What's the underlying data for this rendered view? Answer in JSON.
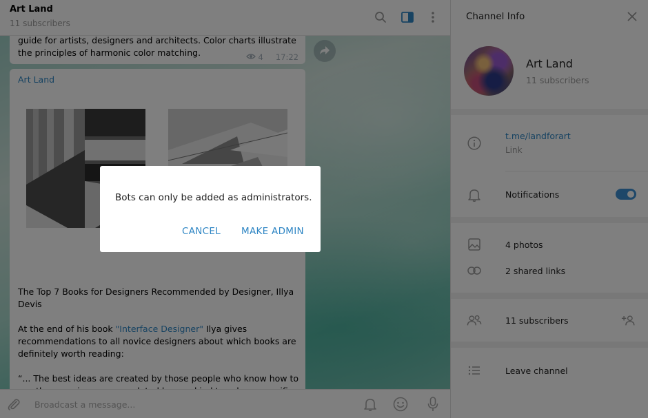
{
  "chat": {
    "title": "Art Land",
    "subtitle": "11 subscribers",
    "top_message": {
      "text": "guide for artists, designers and architects. Color charts illustrate the principles of harmonic color matching.",
      "views": "4",
      "time": "17:22"
    },
    "post": {
      "author": "Art Land",
      "heading": "The Top 7 Books for Designers Recommended by Designer, Illya Devis",
      "para2_pre": "At the end of his book ",
      "para2_link": "\"Interface Designer\"",
      "para2_post": " Ilya gives recommendations to all novice designers about which books are definitely worth reading:",
      "para3": "“... The best ideas are created by those people who know how to use the experience accumulated by mankind to solve a specific problem. That is why it is important for a designer to look at things broadly, reading books of different genres, and communicating with"
    },
    "composer_placeholder": "Broadcast a message..."
  },
  "panel": {
    "title": "Channel Info",
    "name": "Art Land",
    "subscribers": "11 subscribers",
    "link": "t.me/landforart",
    "link_label": "Link",
    "notifications": "Notifications",
    "notifications_on": true,
    "photos": "4 photos",
    "shared_links": "2 shared links",
    "subscribers_row": "11 subscribers",
    "leave": "Leave channel"
  },
  "dialog": {
    "message": "Bots can only be added as administrators.",
    "cancel": "CANCEL",
    "confirm": "MAKE ADMIN"
  },
  "colors": {
    "accent": "#2f86c4",
    "toggle": "#3c8fd2",
    "overlay": "rgba(0,0,0,0.5)"
  },
  "icons": {
    "search": "search-icon",
    "sidebar": "sidebar-toggle-icon",
    "more": "more-vertical-icon",
    "close": "close-icon",
    "info": "info-icon",
    "bell": "bell-icon",
    "photo": "photo-icon",
    "link": "link-icon",
    "users": "users-icon",
    "add_user": "add-user-icon",
    "list": "list-icon",
    "attach": "paperclip-icon",
    "emoji": "emoji-icon",
    "mic": "microphone-icon",
    "eye": "eye-icon",
    "forward": "forward-icon"
  }
}
